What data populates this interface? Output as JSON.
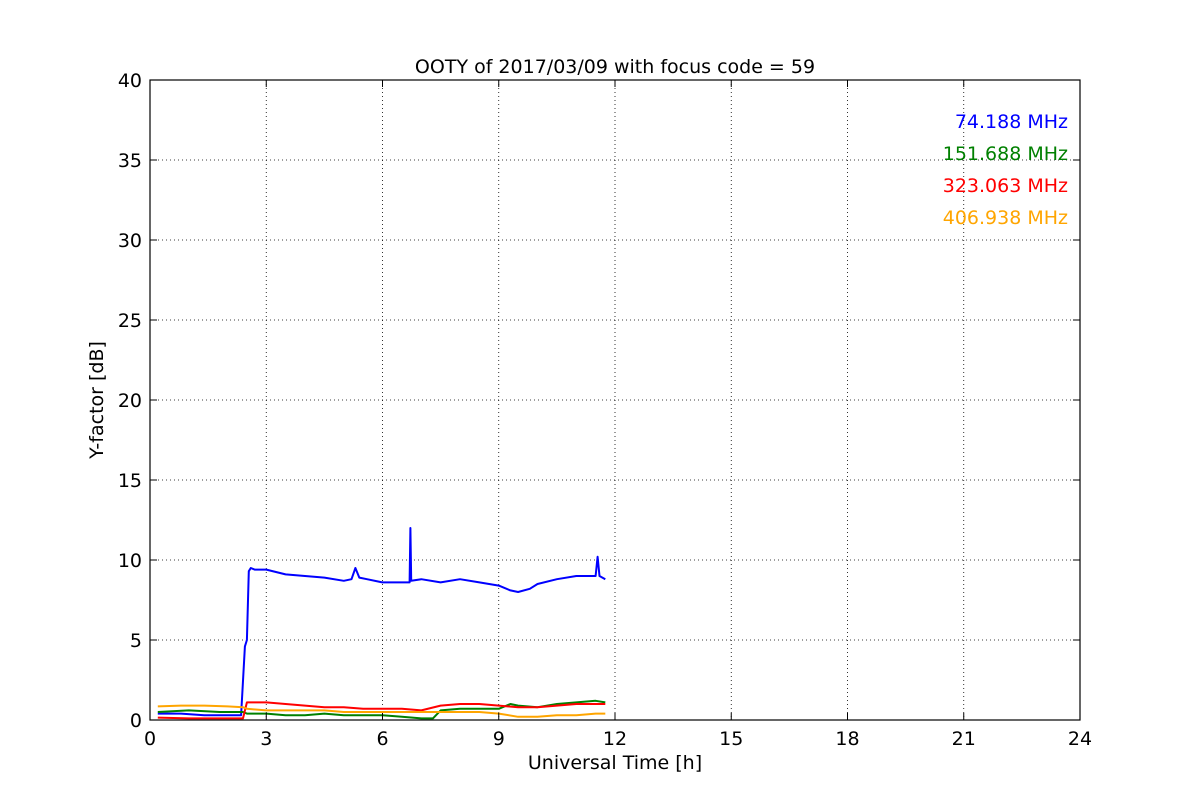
{
  "chart_data": {
    "type": "line",
    "title": "OOTY of 2017/03/09 with focus code = 59",
    "xlabel": "Universal Time [h]",
    "ylabel": "Y-factor [dB]",
    "xlim": [
      0,
      24
    ],
    "ylim": [
      0,
      40
    ],
    "xticks": [
      0,
      3,
      6,
      9,
      12,
      15,
      18,
      21,
      24
    ],
    "yticks": [
      0,
      5,
      10,
      15,
      20,
      25,
      30,
      35,
      40
    ],
    "grid": true,
    "legend_position": "top-right",
    "series": [
      {
        "name": "74.188 MHz",
        "color": "#0000ff",
        "x": [
          0.2,
          0.8,
          1.4,
          2.0,
          2.35,
          2.45,
          2.5,
          2.55,
          2.6,
          2.7,
          3.0,
          3.5,
          4.0,
          4.5,
          5.0,
          5.2,
          5.3,
          5.4,
          5.6,
          6.0,
          6.5,
          6.7,
          6.72,
          6.74,
          7.0,
          7.5,
          8.0,
          8.5,
          9.0,
          9.3,
          9.5,
          9.8,
          10.0,
          10.5,
          11.0,
          11.5,
          11.55,
          11.6,
          11.75
        ],
        "y": [
          0.4,
          0.4,
          0.3,
          0.3,
          0.3,
          4.6,
          5.0,
          9.3,
          9.5,
          9.4,
          9.4,
          9.1,
          9.0,
          8.9,
          8.7,
          8.8,
          9.5,
          8.9,
          8.8,
          8.6,
          8.6,
          8.6,
          12.0,
          8.7,
          8.8,
          8.6,
          8.8,
          8.6,
          8.4,
          8.1,
          8.0,
          8.2,
          8.5,
          8.8,
          9.0,
          9.0,
          10.2,
          9.0,
          8.8
        ]
      },
      {
        "name": "151.688 MHz",
        "color": "#008000",
        "x": [
          0.2,
          1.0,
          1.8,
          2.4,
          2.5,
          3.0,
          3.5,
          4.0,
          4.5,
          5.0,
          5.5,
          6.0,
          6.5,
          7.0,
          7.3,
          7.5,
          8.0,
          8.5,
          9.0,
          9.3,
          9.5,
          10.0,
          10.5,
          11.0,
          11.5,
          11.75
        ],
        "y": [
          0.5,
          0.6,
          0.5,
          0.5,
          0.4,
          0.4,
          0.3,
          0.3,
          0.4,
          0.3,
          0.3,
          0.3,
          0.2,
          0.1,
          0.1,
          0.6,
          0.7,
          0.7,
          0.7,
          1.0,
          0.9,
          0.8,
          1.0,
          1.1,
          1.2,
          1.1
        ]
      },
      {
        "name": "323.063 MHz",
        "color": "#ff0000",
        "x": [
          0.2,
          1.0,
          2.0,
          2.4,
          2.5,
          3.0,
          3.5,
          4.0,
          4.5,
          5.0,
          5.5,
          6.0,
          6.5,
          7.0,
          7.5,
          8.0,
          8.5,
          9.0,
          9.5,
          10.0,
          10.5,
          11.0,
          11.5,
          11.75
        ],
        "y": [
          0.15,
          0.1,
          0.1,
          0.1,
          1.1,
          1.1,
          1.0,
          0.9,
          0.8,
          0.8,
          0.7,
          0.7,
          0.7,
          0.6,
          0.9,
          1.0,
          1.0,
          0.9,
          0.8,
          0.8,
          0.9,
          1.0,
          1.0,
          1.0
        ]
      },
      {
        "name": "406.938 MHz",
        "color": "#ffa500",
        "x": [
          0.2,
          0.8,
          1.4,
          2.0,
          2.4,
          2.5,
          3.0,
          3.5,
          4.0,
          4.5,
          5.0,
          5.5,
          6.0,
          6.5,
          7.0,
          7.5,
          8.0,
          8.5,
          9.0,
          9.5,
          10.0,
          10.5,
          11.0,
          11.5,
          11.75
        ],
        "y": [
          0.85,
          0.9,
          0.9,
          0.85,
          0.8,
          0.7,
          0.6,
          0.6,
          0.6,
          0.6,
          0.5,
          0.5,
          0.5,
          0.5,
          0.5,
          0.5,
          0.5,
          0.5,
          0.4,
          0.2,
          0.2,
          0.3,
          0.3,
          0.4,
          0.4
        ]
      }
    ]
  }
}
